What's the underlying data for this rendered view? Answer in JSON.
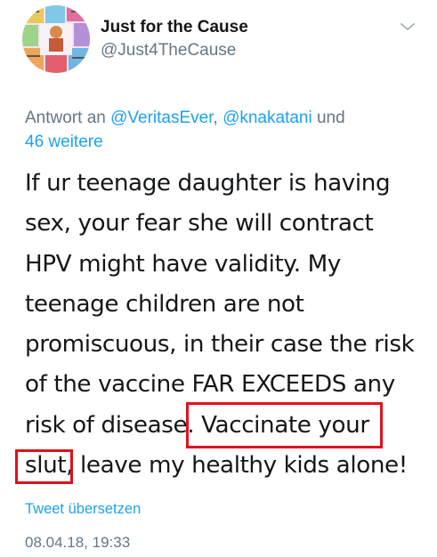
{
  "account": {
    "display_name": "Just for the Cause",
    "handle": "@Just4TheCause",
    "avatar_icon": "profile-photo"
  },
  "reply": {
    "prefix": "Antwort an ",
    "mention_1": "@VeritasEver",
    "separator": ", ",
    "mention_2": "@knakatani",
    "suffix_1": " und",
    "suffix_2": "46 weitere"
  },
  "tweet": {
    "lines": [
      "If ur teenage daughter is having",
      "sex,  your fear she will contract",
      "HPV might have validity. My",
      "teenage children are not",
      "promiscuous, in their case the risk",
      "of the vaccine FAR EXCEEDS any"
    ],
    "line7_a": "risk of disease.",
    "line7_highlight": "Vaccinate your",
    "line8_highlight": "slut,",
    "line8_b": " leave my healthy kids alone!"
  },
  "translate_label": "Tweet übersetzen",
  "timestamp": "08.04.18, 19:33",
  "colors": {
    "link": "#1da1f2",
    "muted": "#657786",
    "text": "#14171a",
    "highlight_box": "#e0111b"
  }
}
